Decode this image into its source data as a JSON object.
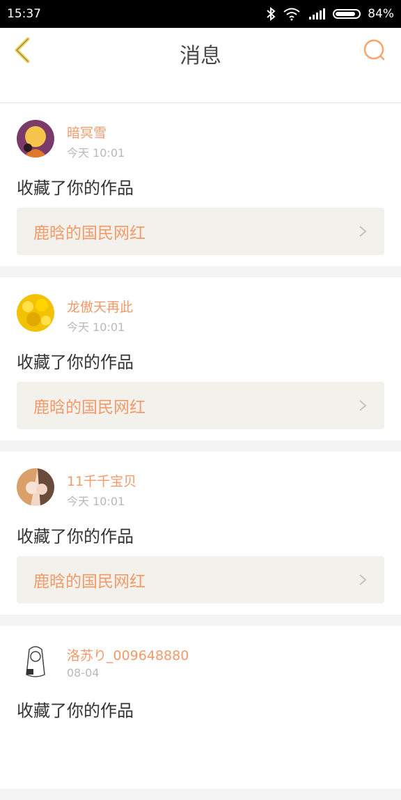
{
  "status_bar": {
    "time": "15:37",
    "battery_text": "84%"
  },
  "header": {
    "title": "消息"
  },
  "colors": {
    "accent": "#f29a6a",
    "header_icon": "#e6d05a",
    "search_icon": "#f6a66c"
  },
  "messages": [
    {
      "name": "暗冥雪",
      "time": "今天 10:01",
      "action": "收藏了你的作品",
      "work_title": "鹿晗的国民网红"
    },
    {
      "name": "龙傲天再此",
      "time": "今天 10:01",
      "action": "收藏了你的作品",
      "work_title": "鹿晗的国民网红"
    },
    {
      "name": "11千千宝贝",
      "time": "今天 10:01",
      "action": "收藏了你的作品",
      "work_title": "鹿晗的国民网红"
    },
    {
      "name": "洛苏り_009648880",
      "time": "08-04",
      "action": "收藏了你的作品",
      "work_title": ""
    }
  ]
}
